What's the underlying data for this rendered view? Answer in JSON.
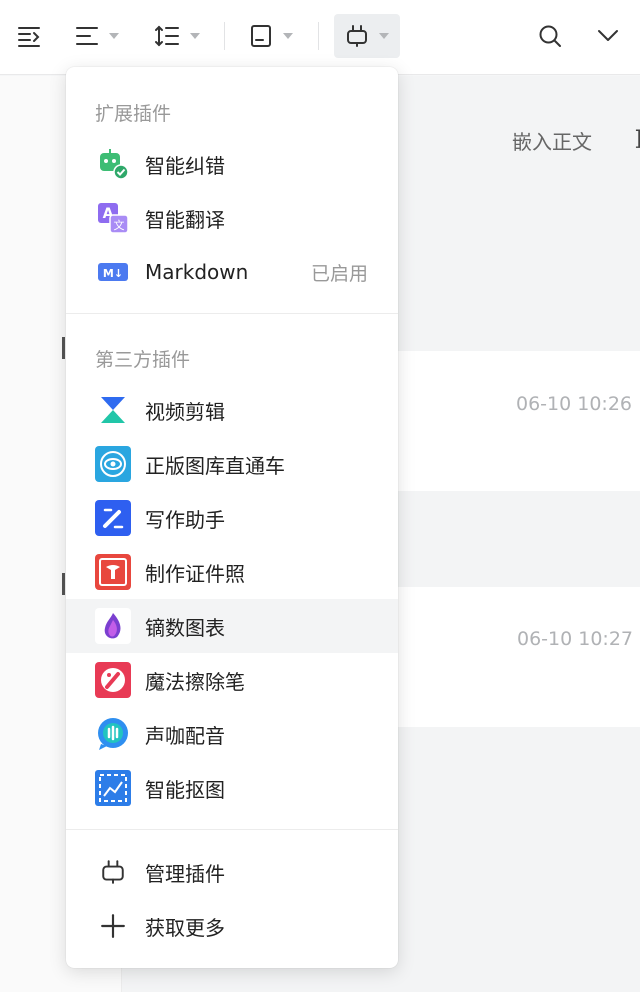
{
  "background": {
    "tab_label": "嵌入正文",
    "tab_edge": "]",
    "card_times": [
      "06-10 10:26",
      "06-10 10:27"
    ]
  },
  "menu": {
    "ext_title": "扩展插件",
    "ext_items": [
      {
        "label": "智能纠错",
        "icon": "robot-check-icon"
      },
      {
        "label": "智能翻译",
        "icon": "translate-icon"
      },
      {
        "label": "Markdown",
        "icon": "markdown-icon",
        "badge": "已启用"
      }
    ],
    "third_title": "第三方插件",
    "third_items": [
      {
        "label": "视频剪辑",
        "icon": "video-edit-icon"
      },
      {
        "label": "正版图库直通车",
        "icon": "image-library-icon"
      },
      {
        "label": "写作助手",
        "icon": "writing-assistant-icon"
      },
      {
        "label": "制作证件照",
        "icon": "id-photo-icon"
      },
      {
        "label": "镝数图表",
        "icon": "dishu-chart-icon"
      },
      {
        "label": "魔法擦除笔",
        "icon": "magic-eraser-icon"
      },
      {
        "label": "声咖配音",
        "icon": "voice-dubbing-icon"
      },
      {
        "label": "智能抠图",
        "icon": "smart-cutout-icon"
      }
    ],
    "manage_label": "管理插件",
    "more_label": "获取更多"
  },
  "colors": {
    "accent_blue": "#3b6ff0",
    "check_green": "#2fa86a",
    "hover_bg": "#f3f4f5"
  }
}
